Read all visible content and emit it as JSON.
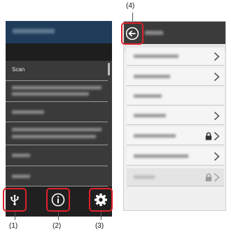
{
  "left_screen": {
    "menu_items": [
      {
        "label": "Scan"
      },
      {
        "label": ""
      },
      {
        "label": ""
      },
      {
        "label": ""
      },
      {
        "label": ""
      },
      {
        "label": ""
      }
    ],
    "bottom_icons": [
      {
        "icon": "usb-icon",
        "callout": "(1)"
      },
      {
        "icon": "info-icon",
        "callout": "(2)"
      },
      {
        "icon": "gear-icon",
        "callout": "(3)"
      }
    ]
  },
  "right_screen": {
    "back_icon": "back-arrow-icon",
    "back_callout": "(4)",
    "rows": [
      {
        "has_chevron": true,
        "has_lock": false,
        "enabled": true
      },
      {
        "has_chevron": true,
        "has_lock": false,
        "enabled": true
      },
      {
        "has_chevron": false,
        "has_lock": false,
        "enabled": true
      },
      {
        "has_chevron": true,
        "has_lock": false,
        "enabled": true
      },
      {
        "has_chevron": true,
        "has_lock": true,
        "enabled": true
      },
      {
        "has_chevron": true,
        "has_lock": false,
        "enabled": true
      },
      {
        "has_chevron": true,
        "has_lock": true,
        "enabled": false
      }
    ]
  },
  "colors": {
    "callout_red": "#e0212a",
    "left_title_bar": "#1f3c5a",
    "right_header": "#3b3b3b"
  }
}
